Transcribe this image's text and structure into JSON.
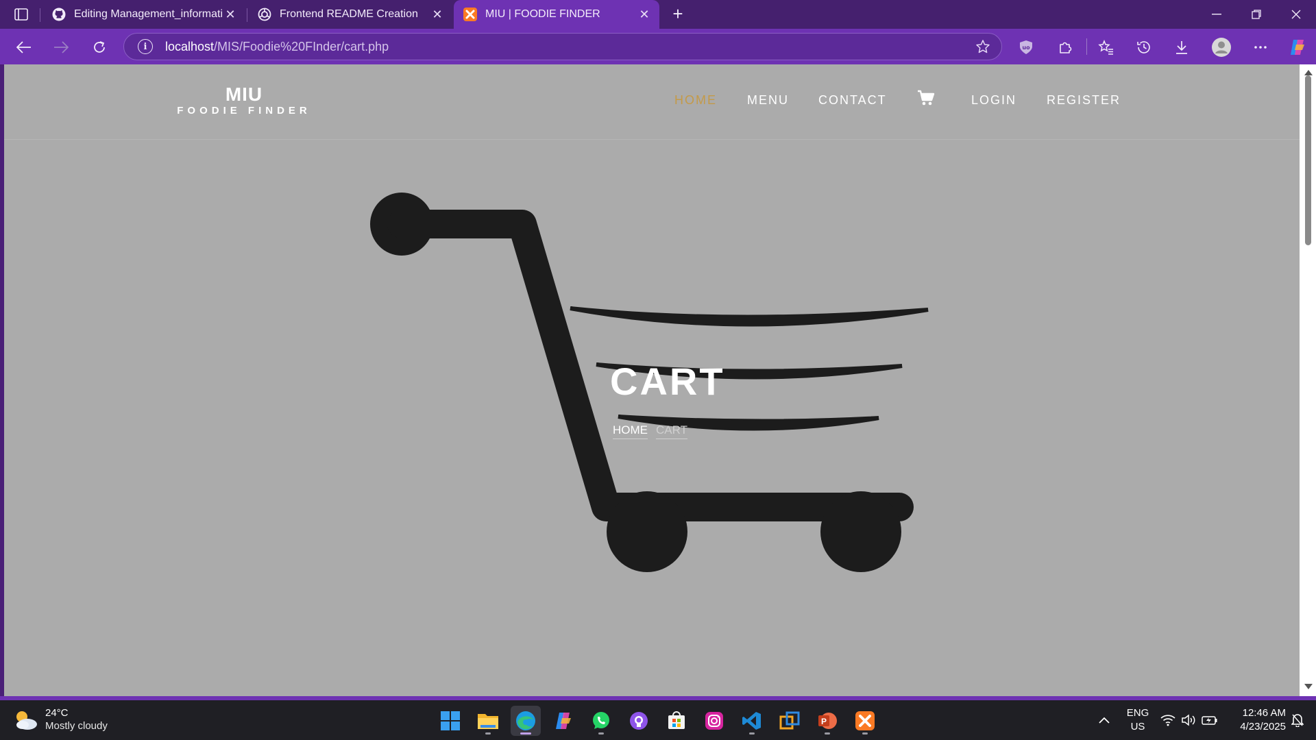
{
  "browser": {
    "tabs": [
      {
        "title": "Editing Management_information",
        "favicon": "github-icon",
        "active": false
      },
      {
        "title": "Frontend README Creation",
        "favicon": "openai-icon",
        "active": false
      },
      {
        "title": "MIU | FOODIE FINDER",
        "favicon": "xampp-icon",
        "active": true
      }
    ],
    "url_host": "localhost",
    "url_path": "/MIS/Foodie%20FInder/cart.php",
    "theme_color": "#6e32b3"
  },
  "site": {
    "logo_line1": "MIU",
    "logo_line2": "FOODIE FINDER",
    "nav": {
      "home": "HOME",
      "menu": "MENU",
      "contact": "CONTACT",
      "login": "LOGIN",
      "register": "REGISTER"
    },
    "active_nav": "home",
    "accent_color": "#c49a48",
    "hero": {
      "title": "CART",
      "breadcrumb_home": "HOME",
      "breadcrumb_current": "CART",
      "background_icon": "shopping-cart-icon"
    }
  },
  "taskbar": {
    "weather_temp": "24°C",
    "weather_desc": "Mostly cloudy",
    "apps": [
      "windows-start-icon",
      "file-explorer-icon",
      "edge-icon",
      "copilot-icon",
      "whatsapp-icon",
      "github-desktop-icon",
      "microsoft-store-icon",
      "instagram-icon",
      "vscode-icon",
      "remote-desktop-icon",
      "powerpoint-icon",
      "xampp-icon"
    ],
    "lang_line1": "ENG",
    "lang_line2": "US",
    "time": "12:46 AM",
    "date": "4/23/2025"
  }
}
